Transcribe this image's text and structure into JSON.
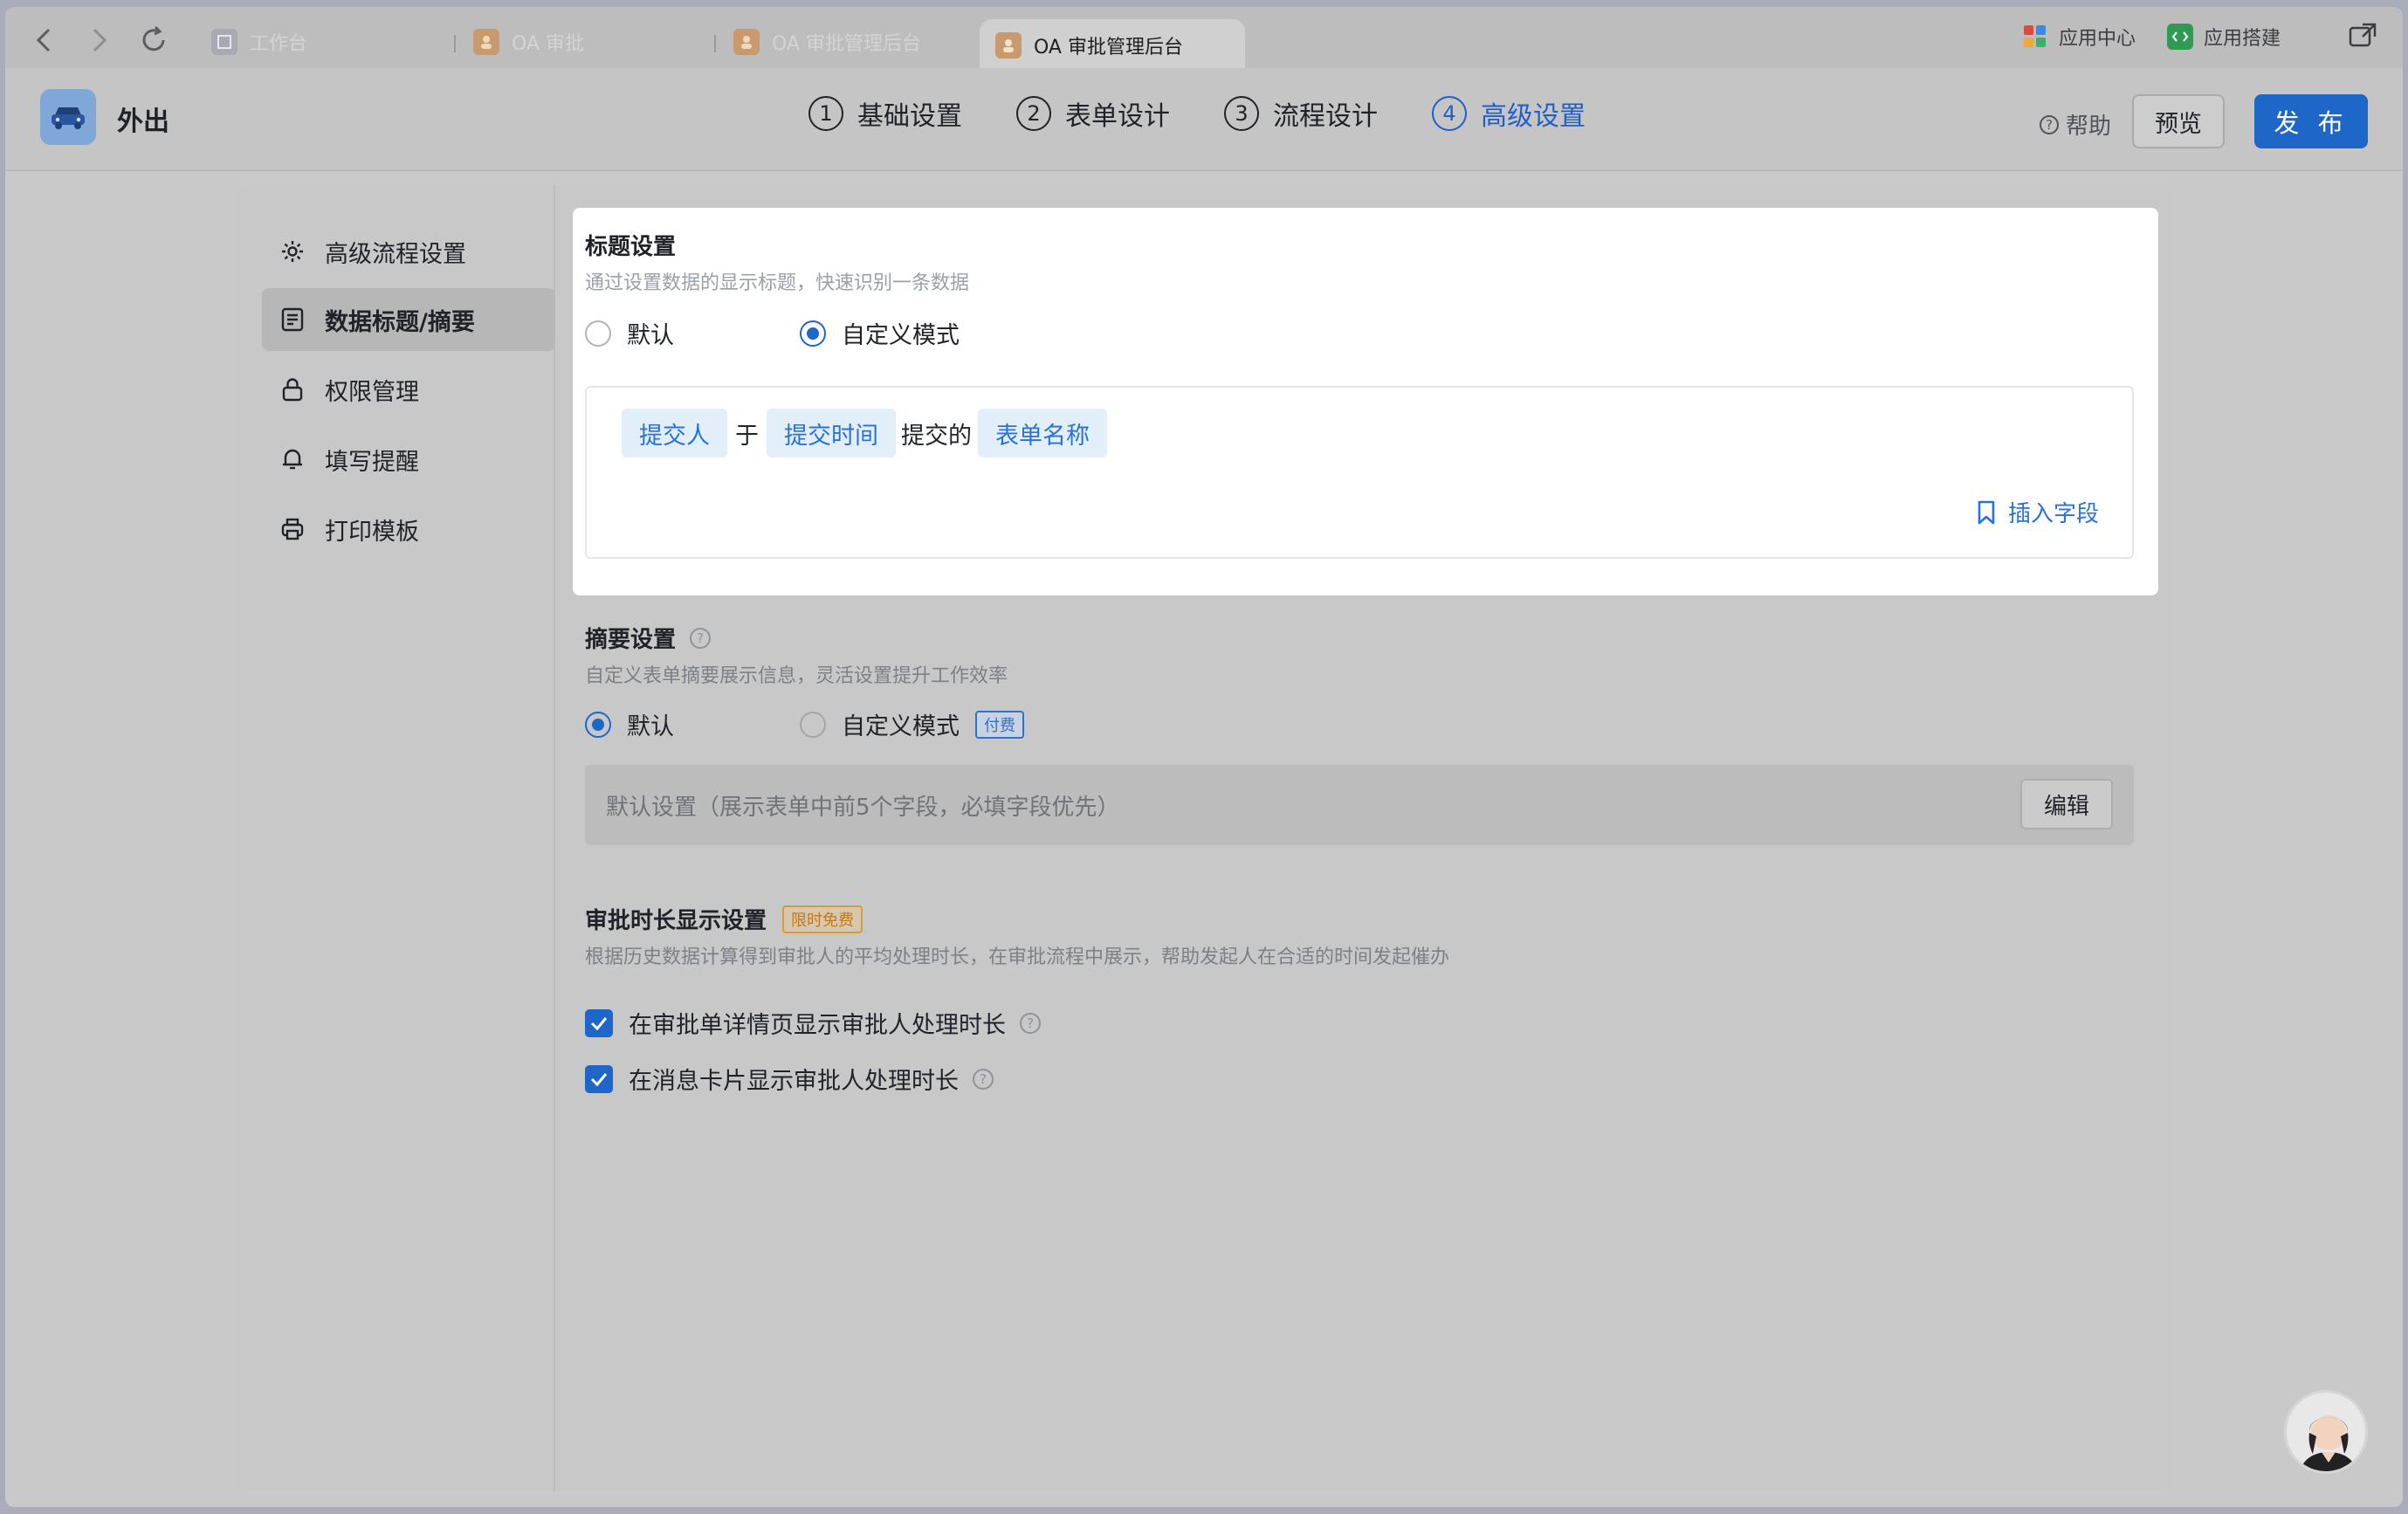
{
  "tabs": [
    {
      "label": "工作台",
      "active": false
    },
    {
      "label": "OA 审批",
      "active": false
    },
    {
      "label": "OA 审批管理后台",
      "active": false
    },
    {
      "label": "OA 审批管理后台",
      "active": true
    }
  ],
  "topbar": {
    "app_center": "应用中心",
    "app_builder": "应用搭建"
  },
  "header": {
    "app_name": "外出",
    "steps": [
      {
        "num": "1",
        "label": "基础设置"
      },
      {
        "num": "2",
        "label": "表单设计"
      },
      {
        "num": "3",
        "label": "流程设计"
      },
      {
        "num": "4",
        "label": "高级设置"
      }
    ],
    "help": "帮助",
    "preview": "预览",
    "publish": "发 布"
  },
  "sidebar": {
    "items": [
      {
        "label": "高级流程设置",
        "icon": "gear-icon"
      },
      {
        "label": "数据标题/摘要",
        "icon": "document-icon"
      },
      {
        "label": "权限管理",
        "icon": "lock-icon"
      },
      {
        "label": "填写提醒",
        "icon": "bell-icon"
      },
      {
        "label": "打印模板",
        "icon": "printer-icon"
      }
    ],
    "active_index": 1
  },
  "title_settings": {
    "title": "标题设置",
    "desc": "通过设置数据的显示标题，快速识别一条数据",
    "option_default": "默认",
    "option_custom": "自定义模式",
    "selected": "custom",
    "tokens": {
      "submitter": "提交人",
      "at": "于",
      "submit_time": "提交时间",
      "submitted": "提交的",
      "form_name": "表单名称"
    },
    "insert_field": "插入字段"
  },
  "summary_settings": {
    "title": "摘要设置",
    "desc": "自定义表单摘要展示信息，灵活设置提升工作效率",
    "option_default": "默认",
    "option_custom": "自定义模式",
    "paid_tag": "付费",
    "selected": "default",
    "default_text": "默认设置（展示表单中前5个字段，必填字段优先）",
    "edit": "编辑"
  },
  "duration_settings": {
    "title": "审批时长显示设置",
    "tag": "限时免费",
    "desc": "根据历史数据计算得到审批人的平均处理时长，在审批流程中展示，帮助发起人在合适的时间发起催办",
    "check1": "在审批单详情页显示审批人处理时长",
    "check2": "在消息卡片显示审批人处理时长"
  },
  "colors": {
    "accent": "#1e66c8",
    "token_bg": "#e3eefb",
    "token_text": "#2a72d8"
  }
}
